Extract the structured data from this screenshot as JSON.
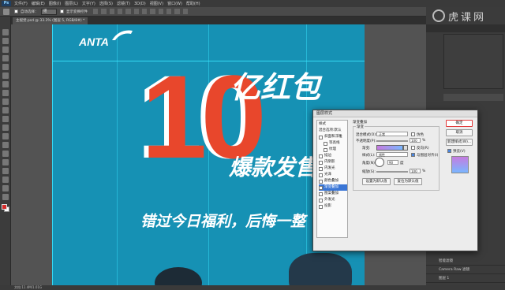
{
  "app": {
    "logo_text": "Ps"
  },
  "menubar": {
    "items": [
      "文件(F)",
      "编辑(E)",
      "图像(I)",
      "图层(L)",
      "文字(Y)",
      "选择(S)",
      "滤镜(T)",
      "3D(D)",
      "视图(V)",
      "窗口(W)",
      "帮助(H)"
    ]
  },
  "options_bar": {
    "auto_select_label": "自动选择：",
    "auto_select_value": "组",
    "show_transform_label": "显示变换控件"
  },
  "document_tab": {
    "title": "主视觉.psd @ 33.3% (图层 5, RGB/8#) *"
  },
  "statusbar": {
    "text": "文档:11.4M/1.01G"
  },
  "canvas": {
    "bg_color": "#1691b4",
    "brand": "ANTA",
    "big_number": "10",
    "headline": "亿红包",
    "subhead": "爆款发售",
    "tagline": "错过今日福利，后悔一整"
  },
  "layer_style_dialog": {
    "title": "图层样式",
    "styles_header": "样式",
    "blend_options": "混合选项:默认",
    "items": [
      {
        "label": "斜面和浮雕",
        "checked": false
      },
      {
        "label": "等高线",
        "checked": false
      },
      {
        "label": "纹理",
        "checked": false
      },
      {
        "label": "描边",
        "checked": false
      },
      {
        "label": "内阴影",
        "checked": false
      },
      {
        "label": "内发光",
        "checked": false
      },
      {
        "label": "光泽",
        "checked": false
      },
      {
        "label": "颜色叠加",
        "checked": false
      },
      {
        "label": "渐变叠加",
        "checked": true,
        "selected": true
      },
      {
        "label": "图案叠加",
        "checked": false
      },
      {
        "label": "外发光",
        "checked": false
      },
      {
        "label": "投影",
        "checked": false
      }
    ],
    "section_title": "渐变叠加",
    "group_title": "渐变",
    "blend_mode_label": "混合模式(O):",
    "blend_mode_value": "正常",
    "dither_label": "仿色",
    "opacity_label": "不透明度(P):",
    "opacity_value": "100",
    "opacity_unit": "%",
    "gradient_label": "渐变:",
    "reverse_label": "反向(R)",
    "style_label": "样式(L):",
    "style_value": "线性",
    "align_label": "与图层对齐(I)",
    "angle_label": "角度(N):",
    "angle_value": "90",
    "angle_unit": "度",
    "scale_label": "缩放(S):",
    "scale_value": "100",
    "scale_unit": "%",
    "set_default_button": "设置为默认值",
    "reset_default_button": "复位为默认值",
    "ok_button": "确定",
    "cancel_button": "取消",
    "new_style_button": "新建样式(W)...",
    "preview_label": "预览(V)"
  },
  "layers": [
    {
      "name": "智能滤镜"
    },
    {
      "name": "Camera Raw 滤镜"
    },
    {
      "name": "图层 1"
    }
  ],
  "watermark": {
    "text": "虎课网"
  }
}
